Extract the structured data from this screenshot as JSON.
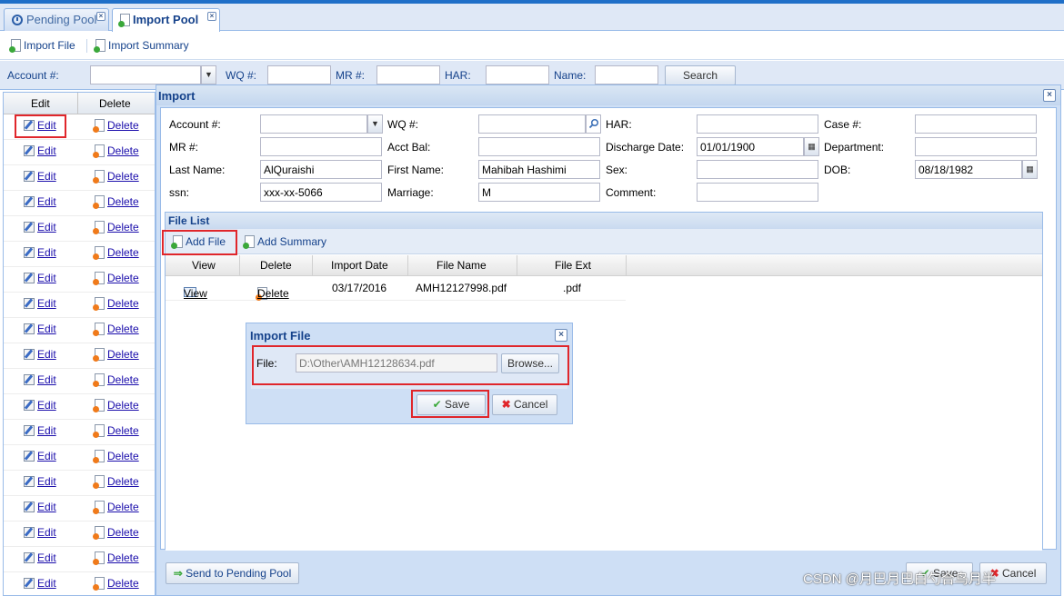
{
  "tabs": [
    {
      "label": "Pending Pool",
      "active": false
    },
    {
      "label": "Import Pool",
      "active": true
    }
  ],
  "toolbar": {
    "import_file": "Import File",
    "import_summary": "Import Summary"
  },
  "search": {
    "account_label": "Account #:",
    "wq_label": "WQ #:",
    "mr_label": "MR #:",
    "har_label": "HAR:",
    "name_label": "Name:",
    "search_button": "Search"
  },
  "grid": {
    "col_edit": "Edit",
    "col_delete": "Delete",
    "rows": [
      {
        "edit": "Edit",
        "delete": "Delete"
      },
      {
        "edit": "Edit",
        "delete": "Delete"
      },
      {
        "edit": "Edit",
        "delete": "Delete"
      },
      {
        "edit": "Edit",
        "delete": "Delete"
      },
      {
        "edit": "Edit",
        "delete": "Delete"
      },
      {
        "edit": "Edit",
        "delete": "Delete"
      },
      {
        "edit": "Edit",
        "delete": "Delete"
      },
      {
        "edit": "Edit",
        "delete": "Delete"
      },
      {
        "edit": "Edit",
        "delete": "Delete"
      },
      {
        "edit": "Edit",
        "delete": "Delete"
      },
      {
        "edit": "Edit",
        "delete": "Delete"
      },
      {
        "edit": "Edit",
        "delete": "Delete"
      },
      {
        "edit": "Edit",
        "delete": "Delete"
      },
      {
        "edit": "Edit",
        "delete": "Delete"
      },
      {
        "edit": "Edit",
        "delete": "Delete"
      },
      {
        "edit": "Edit",
        "delete": "Delete"
      },
      {
        "edit": "Edit",
        "delete": "Delete"
      },
      {
        "edit": "Edit",
        "delete": "Delete"
      },
      {
        "edit": "Edit",
        "delete": "Delete"
      }
    ]
  },
  "import_window": {
    "title": "Import",
    "form": {
      "account_label": "Account #:",
      "account_value": "",
      "wq_label": "WQ #:",
      "wq_value": "",
      "har_label": "HAR:",
      "har_value": "",
      "case_label": "Case #:",
      "case_value": "",
      "mr_label": "MR #:",
      "mr_value": "",
      "acct_bal_label": "Acct Bal:",
      "acct_bal_value": "",
      "discharge_label": "Discharge Date:",
      "discharge_value": "01/01/1900",
      "department_label": "Department:",
      "department_value": "",
      "last_name_label": "Last Name:",
      "last_name_value": "AlQuraishi",
      "first_name_label": "First Name:",
      "first_name_value": "Mahibah Hashimi",
      "sex_label": "Sex:",
      "sex_value": "",
      "dob_label": "DOB:",
      "dob_value": "08/18/1982",
      "ssn_label": "ssn:",
      "ssn_value": "xxx-xx-5066",
      "marriage_label": "Marriage:",
      "marriage_value": "M",
      "comment_label": "Comment:",
      "comment_value": ""
    },
    "file_list": {
      "title": "File List",
      "add_file": "Add File",
      "add_summary": "Add Summary",
      "columns": [
        "View",
        "Delete",
        "Import Date",
        "File Name",
        "File Ext"
      ],
      "rows": [
        {
          "view": "View",
          "delete": "Delete",
          "import_date": "03/17/2016",
          "file_name": "AMH12127998.pdf",
          "file_ext": ".pdf"
        }
      ]
    },
    "send_button": "Send to Pending Pool",
    "save_button": "Save",
    "cancel_button": "Cancel"
  },
  "import_file_dialog": {
    "title": "Import File",
    "file_label": "File:",
    "file_value": "D:\\Other\\AMH12128634.pdf",
    "browse_button": "Browse...",
    "save_button": "Save",
    "cancel_button": "Cancel"
  },
  "watermark": "CSDN @月巴月巴白勺合鸟月半",
  "colors": {
    "accent": "#15428b",
    "panel": "#dfe8f6",
    "highlight_red": "#e0262b",
    "link": "#1a0dab"
  }
}
